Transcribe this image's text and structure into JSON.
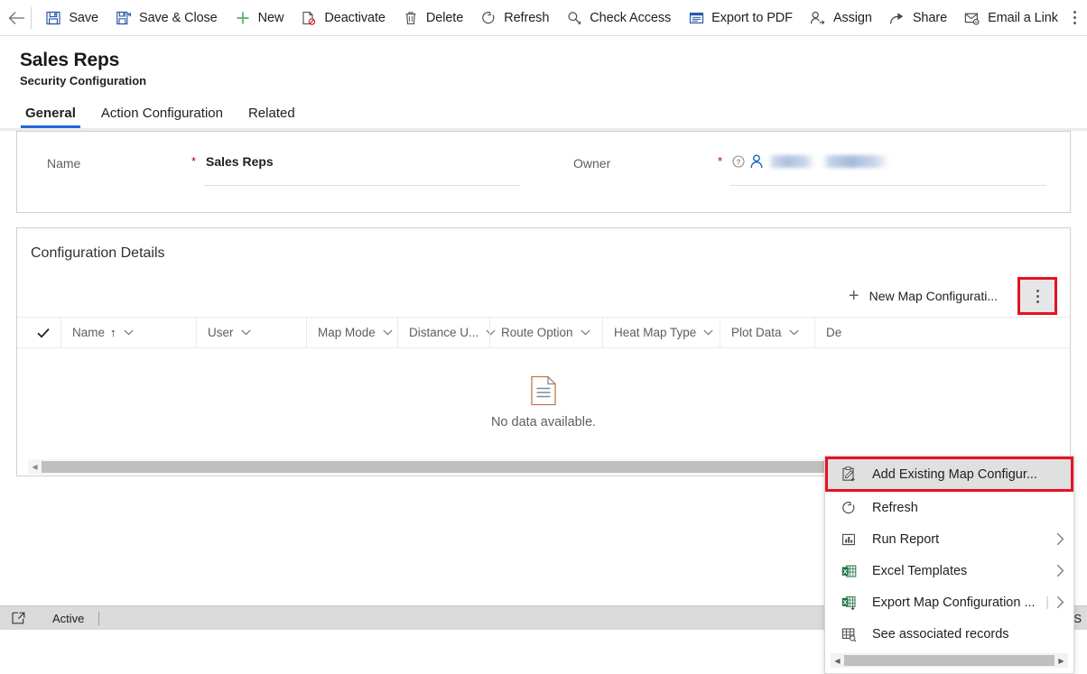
{
  "commandbar": {
    "back_label": "Back",
    "overflow_label": "More commands",
    "items": [
      {
        "label": "Save",
        "icon": "save-icon"
      },
      {
        "label": "Save & Close",
        "icon": "save-and-close-icon"
      },
      {
        "label": "New",
        "icon": "plus-icon"
      },
      {
        "label": "Deactivate",
        "icon": "deactivate-icon"
      },
      {
        "label": "Delete",
        "icon": "trash-icon"
      },
      {
        "label": "Refresh",
        "icon": "refresh-icon"
      },
      {
        "label": "Check Access",
        "icon": "key-icon"
      },
      {
        "label": "Export to PDF",
        "icon": "pdf-icon"
      },
      {
        "label": "Assign",
        "icon": "assign-person-icon"
      },
      {
        "label": "Share",
        "icon": "share-icon"
      },
      {
        "label": "Email a Link",
        "icon": "email-link-icon"
      }
    ]
  },
  "header": {
    "title": "Sales Reps",
    "subtitle": "Security Configuration"
  },
  "tabs": [
    {
      "label": "General",
      "active": true
    },
    {
      "label": "Action Configuration",
      "active": false
    },
    {
      "label": "Related",
      "active": false
    }
  ],
  "form": {
    "name_field": {
      "label": "Name",
      "required_marker": "*",
      "value": "Sales Reps"
    },
    "owner_field": {
      "label": "Owner",
      "required_marker": "*",
      "value": ""
    }
  },
  "configuration_details": {
    "title": "Configuration Details",
    "new_button_label": "New Map Configurati...",
    "more_commands_label": "More commands",
    "columns": [
      {
        "label": "Name",
        "sorted": true,
        "sort_arrow": "↑"
      },
      {
        "label": "User"
      },
      {
        "label": "Map Mode"
      },
      {
        "label": "Distance U..."
      },
      {
        "label": "Route Option"
      },
      {
        "label": "Heat Map Type"
      },
      {
        "label": "Plot Data"
      },
      {
        "label": "De"
      }
    ],
    "empty_message": "No data available."
  },
  "context_menu": {
    "items": [
      {
        "label": "Add Existing Map Configur...",
        "icon": "add-existing-record-icon",
        "highlighted": true,
        "submenu": false
      },
      {
        "label": "Refresh",
        "icon": "refresh-icon",
        "highlighted": false,
        "submenu": false
      },
      {
        "label": "Run Report",
        "icon": "report-chart-icon",
        "highlighted": false,
        "submenu": true
      },
      {
        "label": "Excel Templates",
        "icon": "excel-template-icon",
        "highlighted": false,
        "submenu": true
      },
      {
        "label": "Export Map Configuration ...",
        "icon": "excel-export-icon",
        "highlighted": false,
        "submenu": true,
        "divider_before_chevron": true
      },
      {
        "label": "See associated records",
        "icon": "associated-records-icon",
        "highlighted": false,
        "submenu": false
      }
    ]
  },
  "statusbar": {
    "popout_label": "Open in new window",
    "status_text": "Active",
    "save_label": "S"
  },
  "colors": {
    "accent_blue": "#2266dd",
    "highlight_red": "#e81123",
    "required_red": "#a80000",
    "status_bar_bg": "#dadada",
    "panel_border": "#d2d0ce"
  }
}
